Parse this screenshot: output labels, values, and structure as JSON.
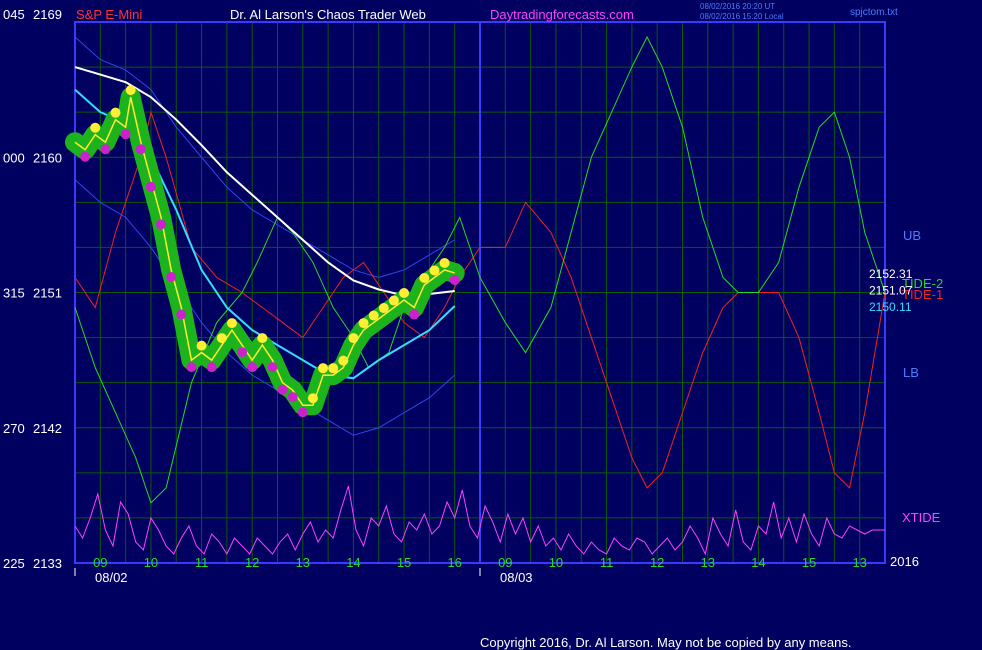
{
  "header": {
    "symbol": "S&P E-Mini",
    "title": "Dr. Al Larson's Chaos Trader Web",
    "site": "Daytradingforecasts.com",
    "timestamp_ut": "08/02/2016 20:20 UT",
    "timestamp_local": "08/02/2016 15:20 Local",
    "file": "spjctom.txt"
  },
  "footer": {
    "copyright": "Copyright 2016, Dr. Al Larson. May not be copied by any means."
  },
  "colors": {
    "background": "#000060",
    "grid": "#0a5a0a",
    "frame": "#3a3aff",
    "price_text": "#ffffff",
    "label_red": "#ff3333",
    "label_pink": "#ff40ff",
    "label_blue": "#4a7cff"
  },
  "chart_data": {
    "type": "line",
    "y_axis": {
      "ticks": [
        {
          "left": "045",
          "value": 2169
        },
        {
          "left": "000",
          "value": 2160
        },
        {
          "left": "315",
          "value": 2151
        },
        {
          "left": "270",
          "value": 2142
        },
        {
          "left": "225",
          "value": 2133
        }
      ],
      "ylim": [
        2133,
        2169
      ]
    },
    "x_axis": {
      "range": [
        8.5,
        24.5
      ],
      "ticks": [
        {
          "x": 9,
          "label": "09"
        },
        {
          "x": 10,
          "label": "10"
        },
        {
          "x": 11,
          "label": "11"
        },
        {
          "x": 12,
          "label": "12"
        },
        {
          "x": 13,
          "label": "13"
        },
        {
          "x": 14,
          "label": "14"
        },
        {
          "x": 15,
          "label": "15"
        },
        {
          "x": 16,
          "label": "16"
        },
        {
          "x": 17,
          "label": "09"
        },
        {
          "x": 18,
          "label": "10"
        },
        {
          "x": 19,
          "label": "11"
        },
        {
          "x": 20,
          "label": "12"
        },
        {
          "x": 21,
          "label": "13"
        },
        {
          "x": 22,
          "label": "14"
        },
        {
          "x": 23,
          "label": "15"
        },
        {
          "x": 24,
          "label": "13"
        }
      ],
      "dates": [
        {
          "x": 8.5,
          "label": "08/02"
        },
        {
          "x": 16.5,
          "label": "08/03"
        }
      ],
      "year": "2016",
      "day_divider_x": 16.5
    },
    "right_labels": {
      "ub": "UB",
      "lb": "LB",
      "xtide": "XTIDE",
      "tide2": "TIDE-2",
      "tide1": "TIDE-1",
      "values": [
        {
          "text": "2152.31",
          "color": "#ffffff",
          "y": 2152.31
        },
        {
          "text": "2151.07",
          "color": "#ffffff",
          "y": 2151.2
        },
        {
          "text": "2150.11",
          "color": "#33ddff",
          "y": 2150.1
        }
      ]
    },
    "series": [
      {
        "name": "TIDE-2",
        "color": "#22dd22",
        "width": 1,
        "x": [
          8.5,
          8.9,
          9.3,
          9.7,
          10.0,
          10.3,
          10.8,
          11.3,
          11.8,
          12.1,
          12.5,
          12.8,
          13.2,
          13.6,
          14.0,
          14.3,
          14.7,
          15.0,
          15.4,
          15.8,
          16.1,
          16.5,
          17.0,
          17.4,
          17.9,
          18.3,
          18.7,
          19.1,
          19.5,
          19.8,
          20.1,
          20.5,
          20.9,
          21.3,
          21.6,
          22.0,
          22.4,
          22.8,
          23.2,
          23.5,
          23.8,
          24.1,
          24.5
        ],
        "y": [
          2150,
          2146,
          2143,
          2140,
          2137,
          2138,
          2145,
          2149,
          2151,
          2153,
          2156,
          2155,
          2153,
          2150,
          2148,
          2146,
          2147,
          2150,
          2152,
          2154,
          2156,
          2152,
          2149,
          2147,
          2150,
          2155,
          2160,
          2163,
          2166,
          2168,
          2166,
          2162,
          2156,
          2152,
          2151,
          2151,
          2153,
          2158,
          2162,
          2163,
          2160,
          2155,
          2151
        ]
      },
      {
        "name": "TIDE-1",
        "color": "#ee2222",
        "width": 1,
        "x": [
          8.5,
          8.9,
          9.3,
          9.6,
          9.8,
          10.0,
          10.3,
          10.8,
          11.3,
          11.8,
          12.2,
          12.6,
          13.0,
          13.4,
          13.8,
          14.2,
          14.6,
          15.0,
          15.4,
          15.8,
          16.1,
          16.5,
          17.0,
          17.4,
          17.9,
          18.3,
          18.7,
          19.1,
          19.5,
          19.8,
          20.1,
          20.5,
          20.9,
          21.3,
          21.6,
          22.0,
          22.4,
          22.8,
          23.2,
          23.5,
          23.8,
          24.1,
          24.5
        ],
        "y": [
          2152,
          2150,
          2155,
          2158,
          2160,
          2163,
          2160,
          2154,
          2152,
          2151,
          2150,
          2149,
          2148,
          2150,
          2152,
          2153,
          2151,
          2149,
          2148,
          2150,
          2152,
          2154,
          2154,
          2157,
          2155,
          2152,
          2148,
          2144,
          2140,
          2138,
          2139,
          2143,
          2147,
          2150,
          2151,
          2151,
          2151,
          2148,
          2143,
          2139,
          2138,
          2143,
          2151
        ]
      },
      {
        "name": "UB",
        "color": "#3344ee",
        "width": 1,
        "x": [
          8.5,
          9.0,
          9.5,
          10.0,
          10.5,
          11.0,
          11.5,
          12.0,
          12.5,
          13.0,
          13.5,
          14.0,
          14.5,
          15.0,
          15.5,
          16.0
        ],
        "y": [
          2168,
          2166.5,
          2165.8,
          2164.5,
          2162,
          2160,
          2158,
          2156.5,
          2155.5,
          2154.5,
          2153.5,
          2152.5,
          2152,
          2152.5,
          2153.5,
          2154.5
        ]
      },
      {
        "name": "LB",
        "color": "#3344ee",
        "width": 1,
        "x": [
          8.5,
          9.0,
          9.5,
          10.0,
          10.5,
          11.0,
          11.5,
          12.0,
          12.5,
          13.0,
          13.5,
          14.0,
          14.5,
          15.0,
          15.5,
          16.0
        ],
        "y": [
          2158.5,
          2157,
          2156,
          2154,
          2151.5,
          2149,
          2147,
          2145.5,
          2144.5,
          2143.5,
          2142.5,
          2141.5,
          2142,
          2143,
          2144,
          2145.5
        ]
      },
      {
        "name": "MA-long",
        "color": "#ffffff",
        "width": 2,
        "x": [
          8.5,
          9.0,
          9.5,
          10.0,
          10.5,
          11.0,
          11.5,
          12.0,
          12.5,
          13.0,
          13.5,
          14.0,
          14.5,
          15.0,
          15.5,
          16.0
        ],
        "y": [
          2166,
          2165.5,
          2165,
          2164,
          2162.5,
          2160.8,
          2159,
          2157.5,
          2156,
          2154.5,
          2153,
          2151.8,
          2151.2,
          2150.8,
          2150.9,
          2151.1
        ]
      },
      {
        "name": "MA-short",
        "color": "#33ddff",
        "width": 2,
        "x": [
          8.5,
          9.0,
          9.5,
          10.0,
          10.5,
          11.0,
          11.5,
          12.0,
          12.5,
          13.0,
          13.5,
          14.0,
          14.5,
          15.0,
          15.5,
          16.0
        ],
        "y": [
          2164.5,
          2163,
          2162.3,
          2160,
          2156.5,
          2152.5,
          2150,
          2148.5,
          2147.5,
          2146.5,
          2145.5,
          2145.3,
          2146.5,
          2147.5,
          2148.5,
          2150.1
        ]
      },
      {
        "name": "price",
        "color": "#ffee33",
        "width": 1.5,
        "x": [
          8.5,
          8.7,
          8.9,
          9.1,
          9.3,
          9.5,
          9.6,
          9.8,
          10.0,
          10.2,
          10.4,
          10.6,
          10.8,
          11.0,
          11.2,
          11.4,
          11.6,
          11.8,
          12.0,
          12.2,
          12.4,
          12.6,
          12.8,
          13.0,
          13.2,
          13.4,
          13.6,
          13.8,
          14.0,
          14.2,
          14.4,
          14.6,
          14.8,
          15.0,
          15.2,
          15.4,
          15.6,
          15.8,
          16.0
        ],
        "y": [
          2161,
          2160.5,
          2161.5,
          2161,
          2162.5,
          2162,
          2164,
          2161,
          2158.5,
          2156,
          2152.5,
          2150,
          2146.5,
          2147,
          2146.5,
          2147.5,
          2148.5,
          2147.5,
          2146.5,
          2147.5,
          2146.5,
          2145,
          2144.5,
          2143.5,
          2143.5,
          2145.5,
          2145.5,
          2146,
          2147.5,
          2148.5,
          2149,
          2149.5,
          2150,
          2150.5,
          2150,
          2151.5,
          2152,
          2152.5,
          2152.3
        ]
      }
    ],
    "xtide": {
      "color": "#ff40ff",
      "amplitude_scale": 1,
      "x": [
        8.5,
        8.65,
        8.8,
        8.95,
        9.1,
        9.25,
        9.4,
        9.55,
        9.7,
        9.85,
        10.0,
        10.15,
        10.3,
        10.45,
        10.6,
        10.75,
        10.9,
        11.05,
        11.2,
        11.35,
        11.5,
        11.65,
        11.8,
        11.95,
        12.1,
        12.25,
        12.4,
        12.55,
        12.7,
        12.85,
        13.0,
        13.15,
        13.3,
        13.45,
        13.6,
        13.75,
        13.9,
        14.05,
        14.2,
        14.35,
        14.5,
        14.65,
        14.8,
        14.95,
        15.1,
        15.25,
        15.4,
        15.55,
        15.7,
        15.85,
        16.0,
        16.15,
        16.3,
        16.45,
        16.6,
        16.75,
        16.9,
        17.05,
        17.2,
        17.35,
        17.5,
        17.65,
        17.8,
        17.95,
        18.1,
        18.25,
        18.4,
        18.55,
        18.7,
        18.85,
        19.0,
        19.15,
        19.3,
        19.45,
        19.6,
        19.75,
        19.9,
        20.05,
        20.2,
        20.35,
        20.5,
        20.65,
        20.8,
        20.95,
        21.1,
        21.25,
        21.4,
        21.55,
        21.7,
        21.85,
        22.0,
        22.15,
        22.3,
        22.45,
        22.6,
        22.75,
        22.9,
        23.05,
        23.2,
        23.35,
        23.5,
        23.65,
        23.8,
        23.95,
        24.1,
        24.25,
        24.5
      ],
      "y": [
        0.45,
        0.3,
        0.55,
        0.85,
        0.4,
        0.2,
        0.75,
        0.6,
        0.25,
        0.15,
        0.55,
        0.4,
        0.2,
        0.1,
        0.3,
        0.45,
        0.2,
        0.1,
        0.35,
        0.25,
        0.1,
        0.3,
        0.2,
        0.1,
        0.3,
        0.2,
        0.1,
        0.25,
        0.35,
        0.15,
        0.35,
        0.5,
        0.25,
        0.4,
        0.3,
        0.65,
        0.95,
        0.4,
        0.2,
        0.55,
        0.45,
        0.7,
        0.35,
        0.25,
        0.5,
        0.4,
        0.6,
        0.35,
        0.45,
        0.75,
        0.55,
        0.9,
        0.45,
        0.3,
        0.7,
        0.5,
        0.25,
        0.6,
        0.35,
        0.55,
        0.25,
        0.45,
        0.2,
        0.3,
        0.15,
        0.35,
        0.2,
        0.1,
        0.25,
        0.15,
        0.1,
        0.3,
        0.2,
        0.15,
        0.3,
        0.25,
        0.1,
        0.2,
        0.3,
        0.15,
        0.25,
        0.45,
        0.3,
        0.1,
        0.55,
        0.35,
        0.2,
        0.65,
        0.25,
        0.15,
        0.45,
        0.35,
        0.75,
        0.3,
        0.55,
        0.25,
        0.6,
        0.35,
        0.2,
        0.55,
        0.35,
        0.3,
        0.45,
        0.4,
        0.35,
        0.4,
        0.4
      ]
    }
  }
}
